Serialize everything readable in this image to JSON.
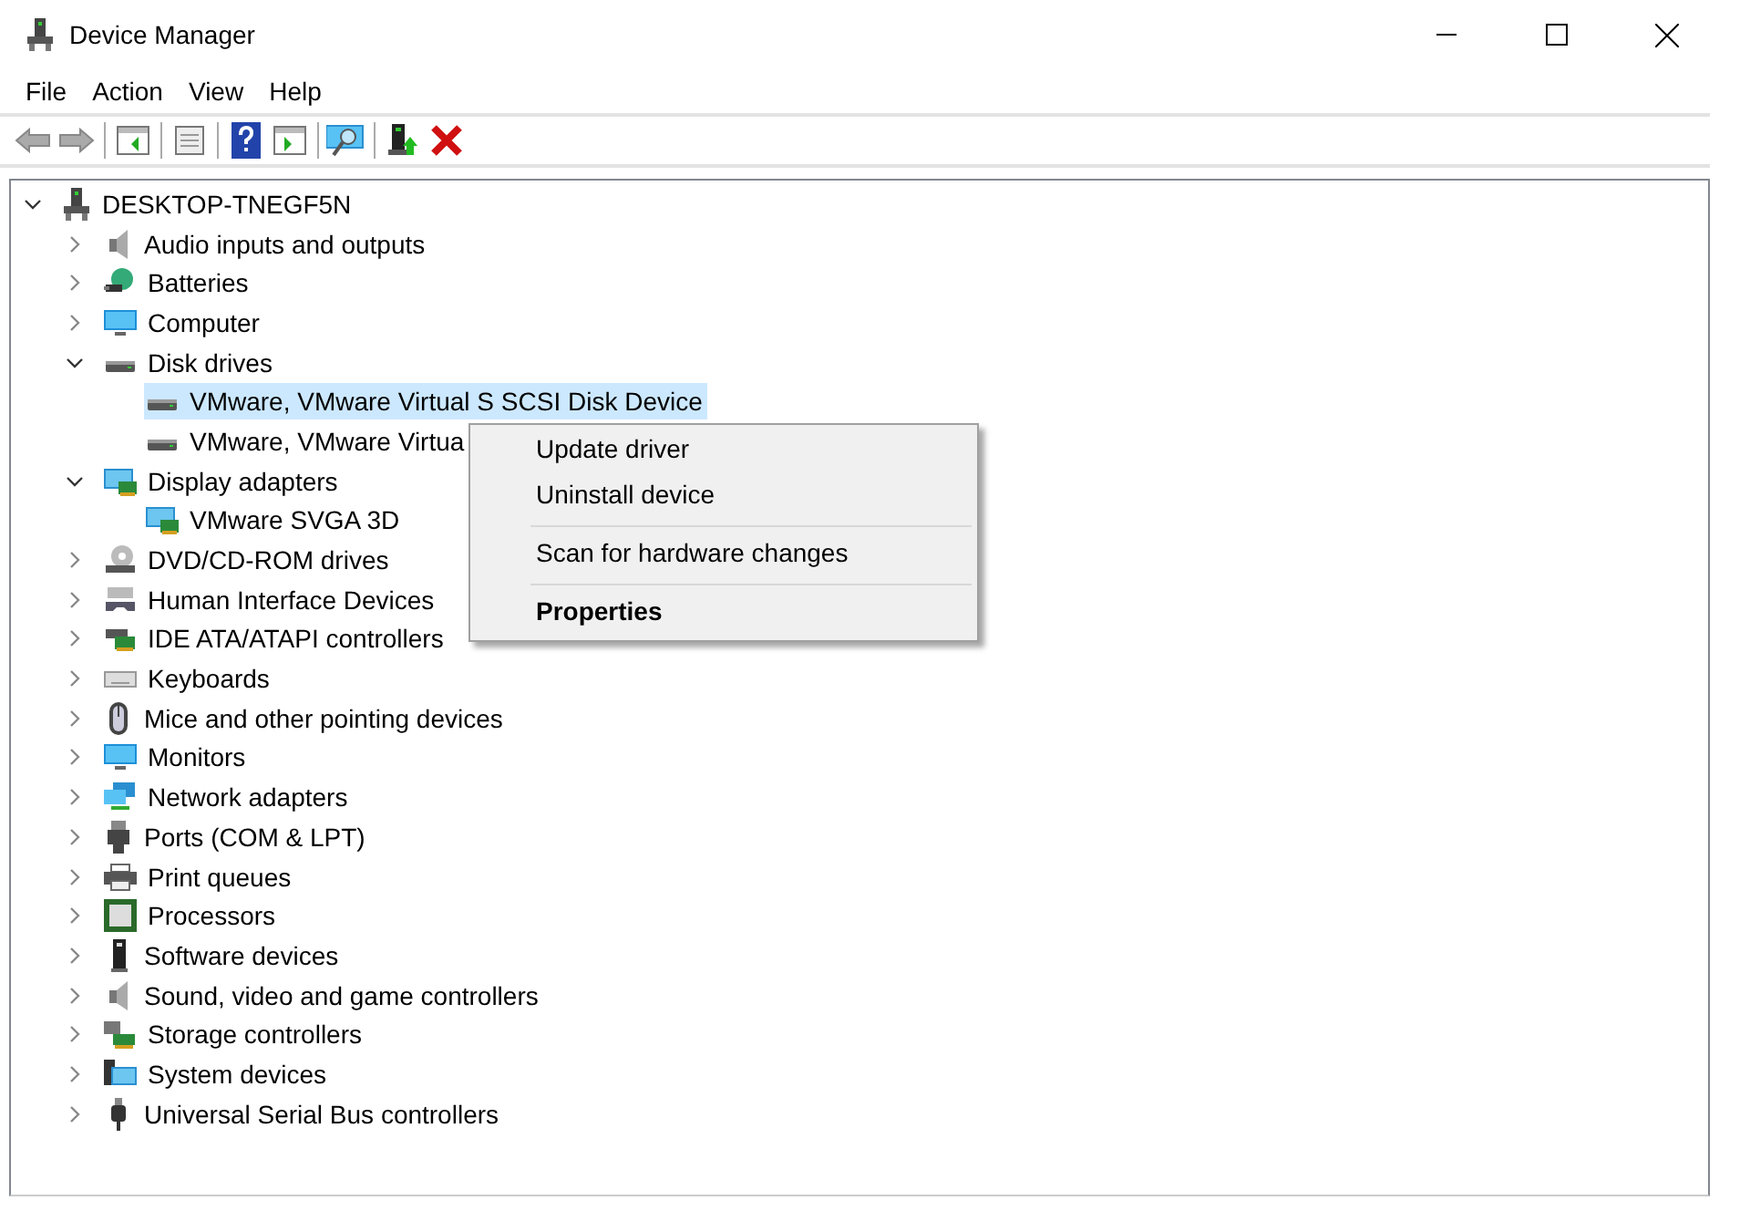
{
  "window": {
    "title": "Device Manager"
  },
  "menu_bar": [
    "File",
    "Action",
    "View",
    "Help"
  ],
  "tree": {
    "label": "DESKTOP-TNEGF5N",
    "expanded": true,
    "selected": false,
    "children": [
      {
        "label": "Audio inputs and outputs",
        "expanded": false,
        "selected": false
      },
      {
        "label": "Batteries",
        "expanded": false,
        "selected": false
      },
      {
        "label": "Computer",
        "expanded": false,
        "selected": false
      },
      {
        "label": "Disk drives",
        "expanded": true,
        "selected": false,
        "children": [
          {
            "label": "VMware, VMware Virtual S SCSI Disk Device",
            "selected": true
          },
          {
            "label": "VMware, VMware Virtua",
            "selected": false
          }
        ]
      },
      {
        "label": "Display adapters",
        "expanded": true,
        "selected": false,
        "children": [
          {
            "label": "VMware SVGA 3D",
            "selected": false
          }
        ]
      },
      {
        "label": "DVD/CD-ROM drives",
        "expanded": false,
        "selected": false
      },
      {
        "label": "Human Interface Devices",
        "expanded": false,
        "selected": false
      },
      {
        "label": "IDE ATA/ATAPI controllers",
        "expanded": false,
        "selected": false
      },
      {
        "label": "Keyboards",
        "expanded": false,
        "selected": false
      },
      {
        "label": "Mice and other pointing devices",
        "expanded": false,
        "selected": false
      },
      {
        "label": "Monitors",
        "expanded": false,
        "selected": false
      },
      {
        "label": "Network adapters",
        "expanded": false,
        "selected": false
      },
      {
        "label": "Ports (COM & LPT)",
        "expanded": false,
        "selected": false
      },
      {
        "label": "Print queues",
        "expanded": false,
        "selected": false
      },
      {
        "label": "Processors",
        "expanded": false,
        "selected": false
      },
      {
        "label": "Software devices",
        "expanded": false,
        "selected": false
      },
      {
        "label": "Sound, video and game controllers",
        "expanded": false,
        "selected": false
      },
      {
        "label": "Storage controllers",
        "expanded": false,
        "selected": false
      },
      {
        "label": "System devices",
        "expanded": false,
        "selected": false
      },
      {
        "label": "Universal Serial Bus controllers",
        "expanded": false,
        "selected": false
      }
    ]
  },
  "context_menu": [
    {
      "kind": "item",
      "label": "Update driver",
      "default": false
    },
    {
      "kind": "item",
      "label": "Uninstall device",
      "default": false
    },
    {
      "kind": "separator"
    },
    {
      "kind": "item",
      "label": "Scan for hardware changes",
      "default": false
    },
    {
      "kind": "separator"
    },
    {
      "kind": "item",
      "label": "Properties",
      "default": true
    }
  ]
}
